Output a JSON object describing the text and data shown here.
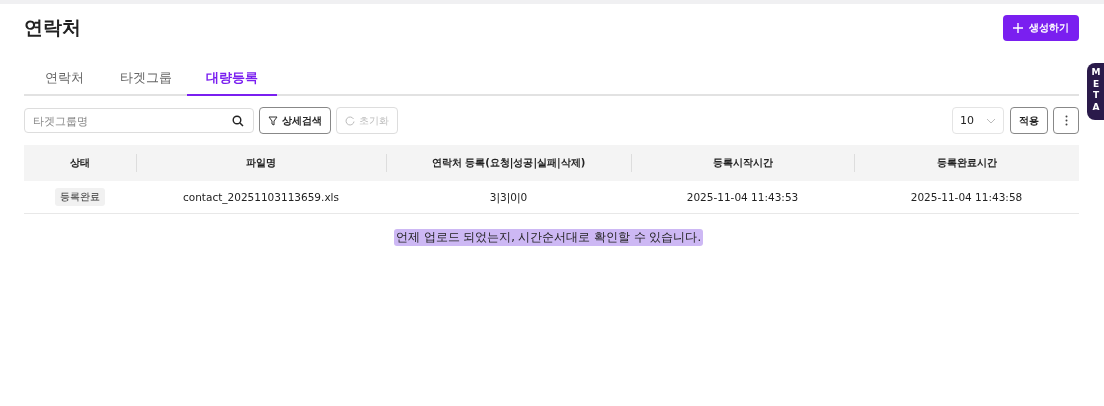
{
  "page": {
    "title": "연락처",
    "create_button": "생성하기"
  },
  "tabs": [
    {
      "label": "연락처",
      "selected": false
    },
    {
      "label": "타겟그룹",
      "selected": false
    },
    {
      "label": "대량등록",
      "selected": true
    }
  ],
  "toolbar": {
    "search": {
      "placeholder": "타겟그룹명"
    },
    "detail_search": "상세검색",
    "reset": {
      "label": "초기화",
      "disabled": true
    },
    "page_size": "10",
    "apply": "적용"
  },
  "table": {
    "columns": [
      "상태",
      "파일명",
      "연락처 등록(요청|성공|실패|삭제)",
      "등록시작시간",
      "등록완료시간"
    ],
    "rows": [
      {
        "status": "등록완료",
        "file": "contact_20251103113659.xls",
        "counts": "3|3|0|0",
        "start": "2025-11-04 11:43:53",
        "end": "2025-11-04 11:43:58"
      }
    ]
  },
  "annotation": "언제 업로드 되었는지, 시간순서대로 확인할 수 있습니다.",
  "side_tab": "META"
}
